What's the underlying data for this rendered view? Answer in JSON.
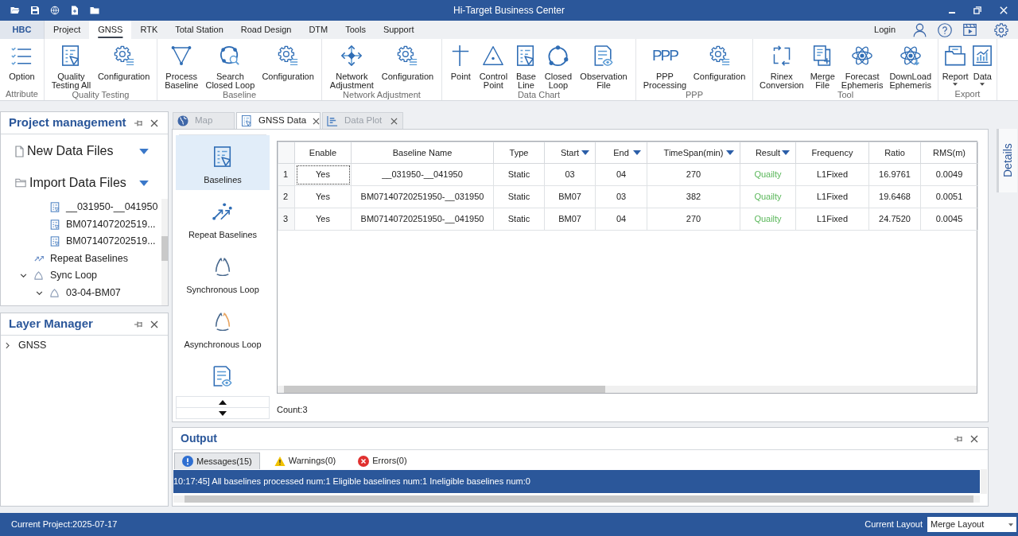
{
  "window": {
    "title": "Hi-Target Business Center"
  },
  "menu_tabs": [
    {
      "label": "HBC",
      "kind": "app",
      "selected": false
    },
    {
      "label": "Project",
      "kind": "tab",
      "selected": false
    },
    {
      "label": "GNSS",
      "kind": "tab",
      "selected": true
    },
    {
      "label": "RTK",
      "kind": "tab",
      "selected": false
    },
    {
      "label": "Total Station",
      "kind": "tab",
      "selected": false
    },
    {
      "label": "Road Design",
      "kind": "tab",
      "selected": false
    },
    {
      "label": "DTM",
      "kind": "tab",
      "selected": false
    },
    {
      "label": "Tools",
      "kind": "tab",
      "selected": false
    },
    {
      "label": "Support",
      "kind": "tab",
      "selected": false
    }
  ],
  "account": {
    "login": "Login"
  },
  "ribbon": [
    {
      "group": "Attribute",
      "buttons": [
        {
          "label": "Option",
          "dropdown": false
        }
      ]
    },
    {
      "group": "Quality Testing",
      "buttons": [
        {
          "label": "Quality\nTesting All",
          "dropdown": false
        },
        {
          "label": "Configuration",
          "dropdown": false
        }
      ]
    },
    {
      "group": "Baseline",
      "buttons": [
        {
          "label": "Process\nBaseline",
          "dropdown": false
        },
        {
          "label": "Search\nClosed Loop",
          "dropdown": false
        },
        {
          "label": "Configuration",
          "dropdown": false
        }
      ]
    },
    {
      "group": "Network Adjustment",
      "buttons": [
        {
          "label": "Network\nAdjustment",
          "dropdown": false
        },
        {
          "label": "Configuration",
          "dropdown": false
        }
      ]
    },
    {
      "group": "Data Chart",
      "buttons": [
        {
          "label": "Point",
          "dropdown": false
        },
        {
          "label": "Control\nPoint",
          "dropdown": false
        },
        {
          "label": "Base\nLine",
          "dropdown": false
        },
        {
          "label": "Closed\nLoop",
          "dropdown": false
        },
        {
          "label": "Observation\nFile",
          "dropdown": false
        }
      ]
    },
    {
      "group": "PPP",
      "buttons": [
        {
          "label": "PPP\nProcessing",
          "logo_text": "PPP",
          "dropdown": false
        },
        {
          "label": "Configuration",
          "dropdown": false
        }
      ]
    },
    {
      "group": "Tool",
      "buttons": [
        {
          "label": "Rinex\nConversion",
          "dropdown": false
        },
        {
          "label": "Merge\nFile",
          "dropdown": false
        },
        {
          "label": "Forecast\nEphemeris",
          "dropdown": false
        },
        {
          "label": "DownLoad\nEphemeris",
          "dropdown": false
        }
      ]
    },
    {
      "group": "Export",
      "buttons": [
        {
          "label": "Report",
          "dropdown": true
        },
        {
          "label": "Data",
          "dropdown": true
        }
      ]
    }
  ],
  "project_panel": {
    "title": "Project management",
    "sections": [
      {
        "label": "New Data Files"
      },
      {
        "label": "Import Data Files"
      }
    ],
    "tree": [
      {
        "kind": "group",
        "children": [
          {
            "kind": "file",
            "label": "__031950-__041950"
          },
          {
            "kind": "file",
            "label": "BM071407202519..."
          },
          {
            "kind": "file",
            "label": "BM071407202519..."
          }
        ]
      },
      {
        "kind": "repeat",
        "label": "Repeat Baselines"
      },
      {
        "kind": "loop",
        "label": "Sync Loop",
        "expanded": true,
        "children": [
          {
            "kind": "loop",
            "label": "03-04-BM07",
            "expanded": true
          }
        ]
      }
    ]
  },
  "layer_panel": {
    "title": "Layer Manager",
    "tree": [
      {
        "label": "GNSS",
        "expanded": false
      }
    ]
  },
  "document_tabs": [
    {
      "label": "Map",
      "selected": false,
      "closable": false
    },
    {
      "label": "GNSS Data",
      "selected": true,
      "closable": true
    },
    {
      "label": "Data Plot",
      "selected": false,
      "closable": true
    }
  ],
  "data_nav": [
    {
      "label": "Baselines",
      "selected": true
    },
    {
      "label": "Repeat Baselines",
      "selected": false
    },
    {
      "label": "Synchronous Loop",
      "selected": false
    },
    {
      "label": "Asynchronous Loop",
      "selected": false
    },
    {
      "selected": false
    }
  ],
  "table": {
    "columns": [
      {
        "label": "Enable",
        "filter": false,
        "kind": "text"
      },
      {
        "label": "Baseline Name",
        "filter": false,
        "kind": "text"
      },
      {
        "label": "Type",
        "filter": false,
        "kind": "text"
      },
      {
        "label": "Start",
        "filter": true,
        "kind": "text"
      },
      {
        "label": "End",
        "filter": true,
        "kind": "text"
      },
      {
        "label": "TimeSpan(min)",
        "filter": true,
        "kind": "text"
      },
      {
        "label": "Result",
        "filter": true,
        "kind": "status"
      },
      {
        "label": "Frequency",
        "filter": false,
        "kind": "text"
      },
      {
        "label": "Ratio",
        "filter": false,
        "kind": "text"
      },
      {
        "label": "RMS(m)",
        "filter": false,
        "kind": "text"
      }
    ],
    "rows": [
      {
        "number": "1",
        "focused": true,
        "cells": [
          "Yes",
          "__031950-__041950",
          "Static",
          "03",
          "04",
          "270",
          "Quailty",
          "L1Fixed",
          "16.9761",
          "0.0049"
        ]
      },
      {
        "number": "2",
        "focused": false,
        "cells": [
          "Yes",
          "BM07140720251950-__031950",
          "Static",
          "BM07",
          "03",
          "382",
          "Quailty",
          "L1Fixed",
          "19.6468",
          "0.0051"
        ]
      },
      {
        "number": "3",
        "focused": false,
        "cells": [
          "Yes",
          "BM07140720251950-__041950",
          "Static",
          "BM07",
          "04",
          "270",
          "Quailty",
          "L1Fixed",
          "24.7520",
          "0.0045"
        ]
      }
    ],
    "count": "Count:3"
  },
  "side_tabs": [
    {
      "label": "Details"
    }
  ],
  "output": {
    "title": "Output",
    "tabs": [
      {
        "label": "Messages(15)",
        "selected": true
      },
      {
        "label": "Warnings(0)",
        "selected": false
      },
      {
        "label": "Errors(0)",
        "selected": false
      }
    ],
    "messages": [
      {
        "text": "10:17:45] All baselines processed num:1 Eligible baselines num:1 Ineligible baselines num:0",
        "selected": true
      }
    ]
  },
  "status_bar": {
    "project": "Current Project:2025-07-17",
    "layout_label": "Current Layout",
    "layout_value": "Merge Layout"
  }
}
